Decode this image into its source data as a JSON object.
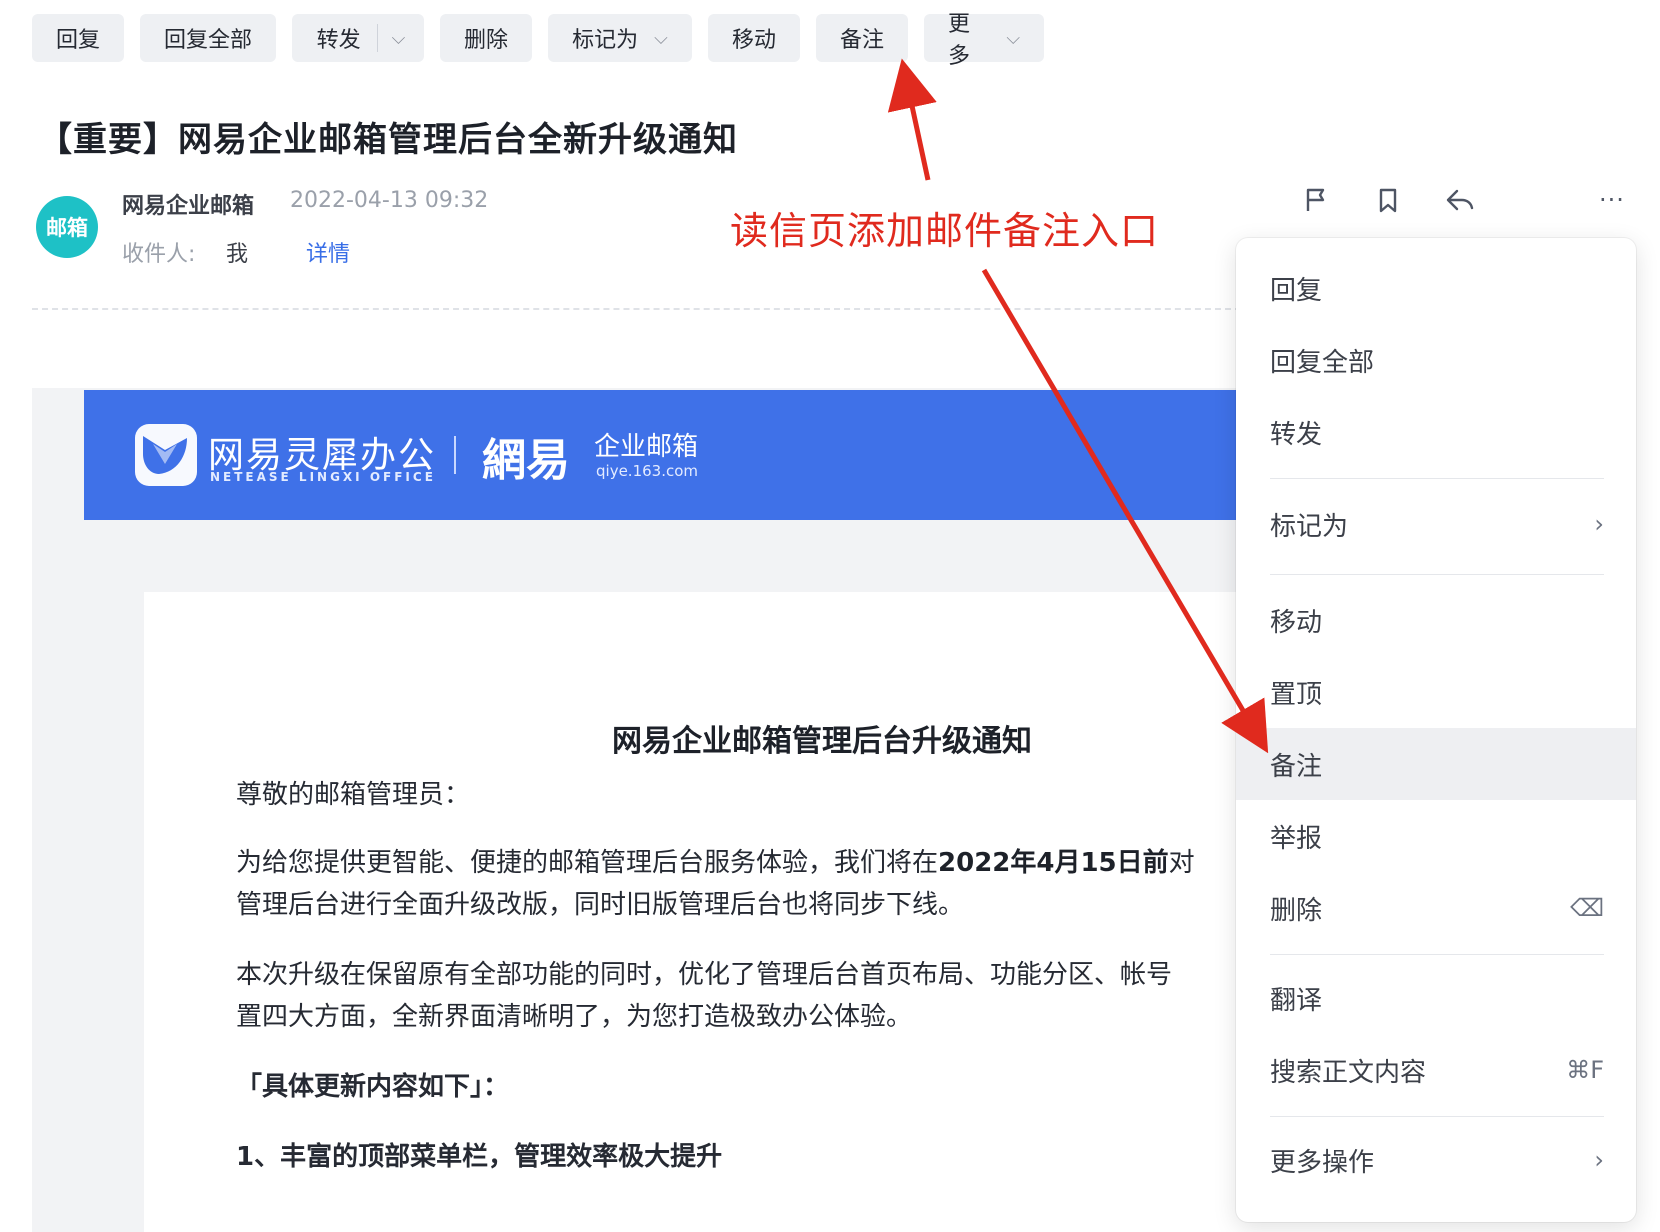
{
  "toolbar": {
    "reply": "回复",
    "reply_all": "回复全部",
    "forward": "转发",
    "delete": "删除",
    "mark_as": "标记为",
    "move": "移动",
    "note": "备注",
    "more": "更多"
  },
  "mail": {
    "subject": "【重要】网易企业邮箱管理后台全新升级通知",
    "avatar_text": "邮箱",
    "sender": "网易企业邮箱",
    "time": "2022-04-13 09:32",
    "recipient_label": "收件人:",
    "recipient": "我",
    "detail": "详情"
  },
  "banner": {
    "brand_cn": "网易灵犀办公",
    "brand_en": "NETEASE LINGXI OFFICE",
    "logo_163": "網易",
    "product": "企业邮箱",
    "url": "qiye.163.com"
  },
  "body": {
    "title": "网易企业邮箱管理后台升级通知",
    "greeting": "尊敬的邮箱管理员：",
    "p1_a": "为给您提供更智能、便捷的邮箱管理后台服务体验，我们将在",
    "p1_bold": "2022年4月15日前",
    "p1_b": "对",
    "p1_line2": "管理后台进行全面升级改版，同时旧版管理后台也将同步下线。",
    "p2_line1": "本次升级在保留原有全部功能的同时，优化了管理后台首页布局、功能分区、帐号",
    "p2_line2": "置四大方面，全新界面清晰明了，为您打造极致办公体验。",
    "section": "「具体更新内容如下」：",
    "item1": "1、丰富的顶部菜单栏，管理效率极大提升"
  },
  "menu": {
    "items": [
      {
        "label": "回复"
      },
      {
        "label": "回复全部"
      },
      {
        "label": "转发"
      },
      {
        "label": "标记为",
        "right": "›"
      },
      {
        "label": "移动"
      },
      {
        "label": "置顶"
      },
      {
        "label": "备注",
        "active": true
      },
      {
        "label": "举报"
      },
      {
        "label": "删除",
        "right": "⌫"
      },
      {
        "label": "翻译"
      },
      {
        "label": "搜索正文内容",
        "right": "⌘F"
      },
      {
        "label": "更多操作",
        "right": "›"
      }
    ]
  },
  "annotation": {
    "text": "读信页添加邮件备注入口",
    "color": "#e02a1e"
  },
  "icons": {
    "flag": "flag-icon",
    "bookmark": "bookmark-icon",
    "reply": "reply-icon",
    "more": "more-icon"
  }
}
